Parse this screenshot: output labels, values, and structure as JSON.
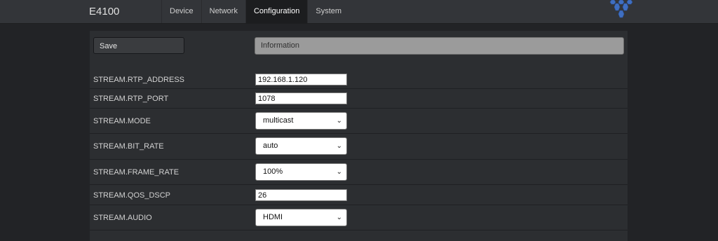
{
  "app": {
    "title": "E4100"
  },
  "nav": {
    "items": [
      {
        "label": "Device"
      },
      {
        "label": "Network"
      },
      {
        "label": "Configuration",
        "active": true
      },
      {
        "label": "System"
      }
    ]
  },
  "toolbar": {
    "save_label": "Save",
    "info_label": "Information"
  },
  "settings": [
    {
      "label": "STREAM.RTP_ADDRESS",
      "type": "text",
      "value": "192.168.1.120"
    },
    {
      "label": "STREAM.RTP_PORT",
      "type": "text",
      "value": "1078"
    },
    {
      "label": "STREAM.MODE",
      "type": "select",
      "value": "multicast"
    },
    {
      "label": "STREAM.BIT_RATE",
      "type": "select",
      "value": "auto"
    },
    {
      "label": "STREAM.FRAME_RATE",
      "type": "select",
      "value": "100%"
    },
    {
      "label": "STREAM.QOS_DSCP",
      "type": "text",
      "value": "26"
    },
    {
      "label": "STREAM.AUDIO",
      "type": "select",
      "value": "HDMI"
    }
  ],
  "icons": {
    "logo": "hexagon-cluster-logo",
    "select_arrow": "chevron-down-icon"
  },
  "colors": {
    "logo": "#3f6fc2",
    "active_tab": "#1c1d1f",
    "info_bar": "#9b9b9b"
  }
}
